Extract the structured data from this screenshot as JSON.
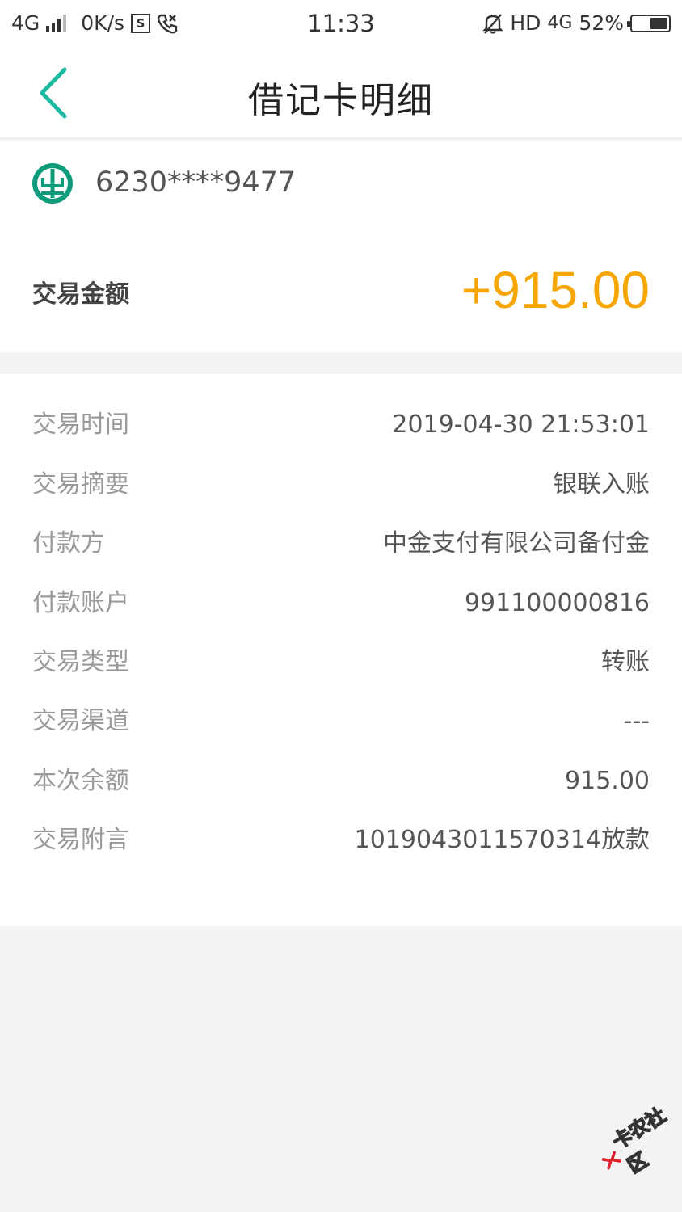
{
  "status_bar": {
    "network": "4G",
    "speed": "0K/s",
    "time": "11:33",
    "hd": "HD",
    "net2": "4G",
    "battery": "52%"
  },
  "nav": {
    "title": "借记卡明细"
  },
  "card": {
    "number": "6230****9477"
  },
  "amount": {
    "label": "交易金额",
    "value": "+915.00"
  },
  "details": [
    {
      "label": "交易时间",
      "value": "2019-04-30 21:53:01"
    },
    {
      "label": "交易摘要",
      "value": "银联入账"
    },
    {
      "label": "付款方",
      "value": "中金支付有限公司备付金"
    },
    {
      "label": "付款账户",
      "value": "991100000816"
    },
    {
      "label": "交易类型",
      "value": "转账"
    },
    {
      "label": "交易渠道",
      "value": "---"
    },
    {
      "label": "本次余额",
      "value": "915.00"
    },
    {
      "label": "交易附言",
      "value": "1019043011570314放款"
    }
  ],
  "watermark": {
    "text": "卡农社区"
  },
  "colors": {
    "accent": "#1ab9a0",
    "amount": "#f7a500",
    "bank_logo": "#0e9b7c"
  }
}
